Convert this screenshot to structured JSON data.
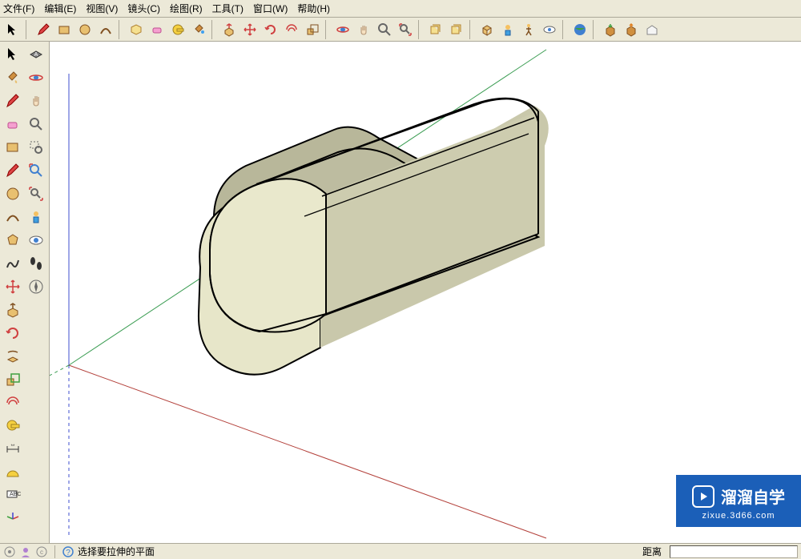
{
  "menubar": {
    "items": [
      "文件(F)",
      "编辑(E)",
      "视图(V)",
      "镜头(C)",
      "绘图(R)",
      "工具(T)",
      "窗口(W)",
      "帮助(H)"
    ]
  },
  "top_tools": [
    "select",
    "pencil",
    "rectangle",
    "circle",
    "arc",
    "component",
    "eraser",
    "tape",
    "paintbucket",
    "pushpull",
    "move-red",
    "rotate-red",
    "offset-red",
    "scale",
    "orbit",
    "pan",
    "zoom",
    "zoom-extents",
    "zoom-window",
    "prev-view",
    "isoview",
    "walk",
    "position-camera",
    "look-around",
    "google-earth",
    "get-models",
    "share-model",
    "3dwarehouse"
  ],
  "left_tools": [
    [
      "select",
      "paintbucket-alt"
    ],
    [
      "pencil-red",
      "eraser"
    ],
    [
      "rectangle-fill",
      "pencil"
    ],
    [
      "circle-fill",
      "arc"
    ],
    [
      "polygon",
      "freehand"
    ],
    [
      "move-red",
      "pushpull"
    ],
    [
      "rotate-red",
      "followme"
    ],
    [
      "scale",
      "offset"
    ],
    [
      "tape",
      "dimension"
    ],
    [
      "protractor",
      "text-label"
    ],
    [
      "axes",
      "section"
    ],
    [
      "orbit",
      "pan"
    ],
    [
      "zoom",
      "zoom-window"
    ],
    [
      "prev",
      "look-around"
    ],
    [
      "walk",
      "camera"
    ],
    [
      "footprints",
      "compass"
    ]
  ],
  "status": {
    "hint": "选择要拉伸的平面",
    "distance_label": "距离"
  },
  "watermark": {
    "title": "溜溜自学",
    "subtitle": "zixue.3d66.com"
  }
}
